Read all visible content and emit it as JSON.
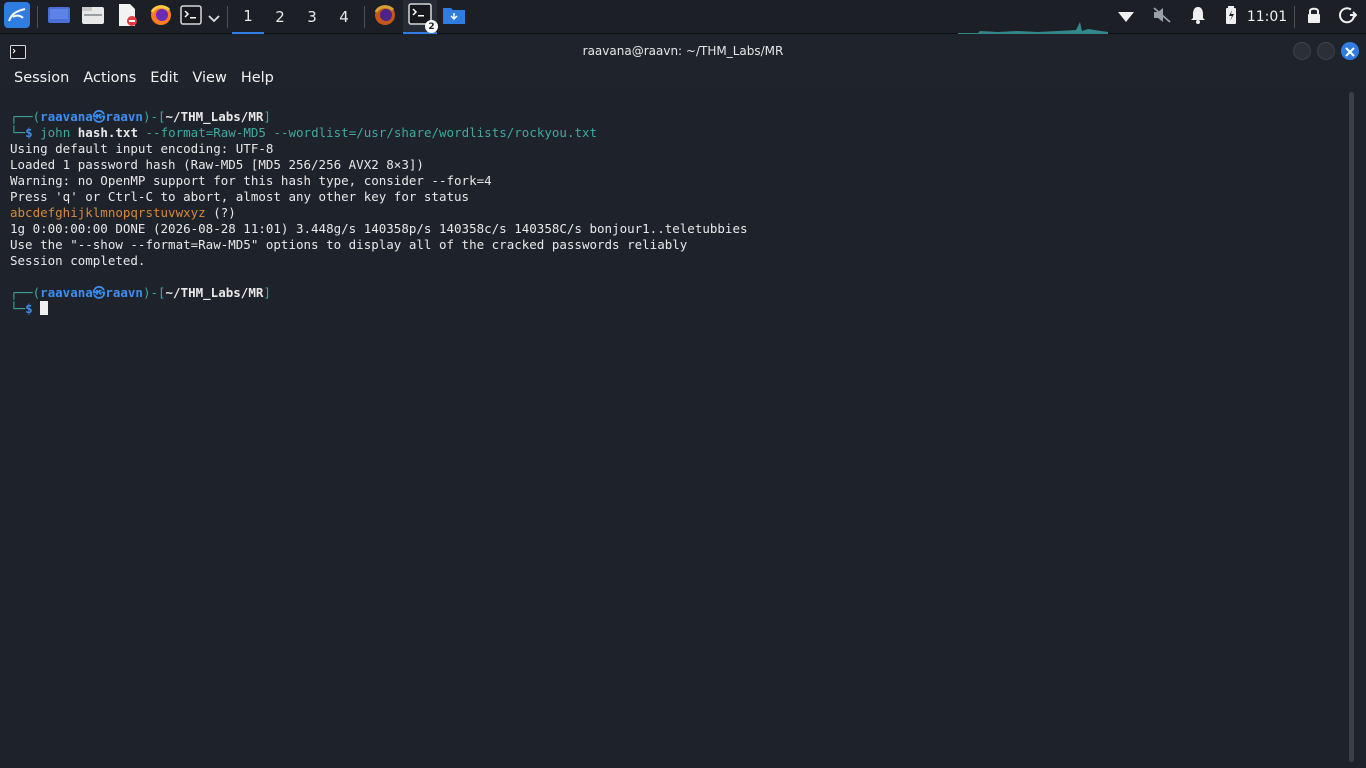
{
  "taskbar": {
    "workspaces": [
      "1",
      "2",
      "3",
      "4"
    ],
    "active_workspace": "1",
    "terminal_badge": "2",
    "clock": "11:01",
    "icons": [
      "kali-menu-icon",
      "desktop-icon",
      "files-icon",
      "text-editor-icon",
      "firefox-icon",
      "terminal-icon",
      "chevron-down-icon",
      "firefox-window-icon",
      "terminal-window-icon",
      "folder-download-icon",
      "wifi-icon",
      "muted-speaker-icon",
      "bell-icon",
      "battery-icon",
      "lock-icon",
      "power-icon"
    ]
  },
  "window": {
    "title": "raavana@raavn: ~/THM_Labs/MR"
  },
  "menubar": {
    "items": [
      "Session",
      "Actions",
      "Edit",
      "View",
      "Help"
    ]
  },
  "terminal": {
    "prompt1": {
      "corner": "┌──(",
      "user": "raavana",
      "at": "㉿",
      "host": "raavn",
      "mid": ")-[",
      "path": "~/THM_Labs/MR",
      "close": "]",
      "corner2": "└─",
      "dollar": "$",
      "cmd": "john",
      "arg1": "hash.txt",
      "rest": "--format=Raw-MD5 --wordlist=/usr/share/wordlists/rockyou.txt"
    },
    "output": [
      "Using default input encoding: UTF-8",
      "Loaded 1 password hash (Raw-MD5 [MD5 256/256 AVX2 8×3])",
      "Warning: no OpenMP support for this hash type, consider --fork=4",
      "Press 'q' or Ctrl-C to abort, almost any other key for status"
    ],
    "cracked_password": "abcdefghijklmnopqrstuvwxyz",
    "cracked_suffix": " (?)",
    "output2": [
      "1g 0:00:00:00 DONE (2026-08-28 11:01) 3.448g/s 140358p/s 140358c/s 140358C/s bonjour1..teletubbies",
      "Use the \"--show --format=Raw-MD5\" options to display all of the cracked passwords reliably",
      "Session completed."
    ],
    "prompt2": {
      "corner": "┌──(",
      "user": "raavana",
      "at": "㉿",
      "host": "raavn",
      "mid": ")-[",
      "path": "~/THM_Labs/MR",
      "close": "]",
      "corner2": "└─",
      "dollar": "$"
    }
  }
}
